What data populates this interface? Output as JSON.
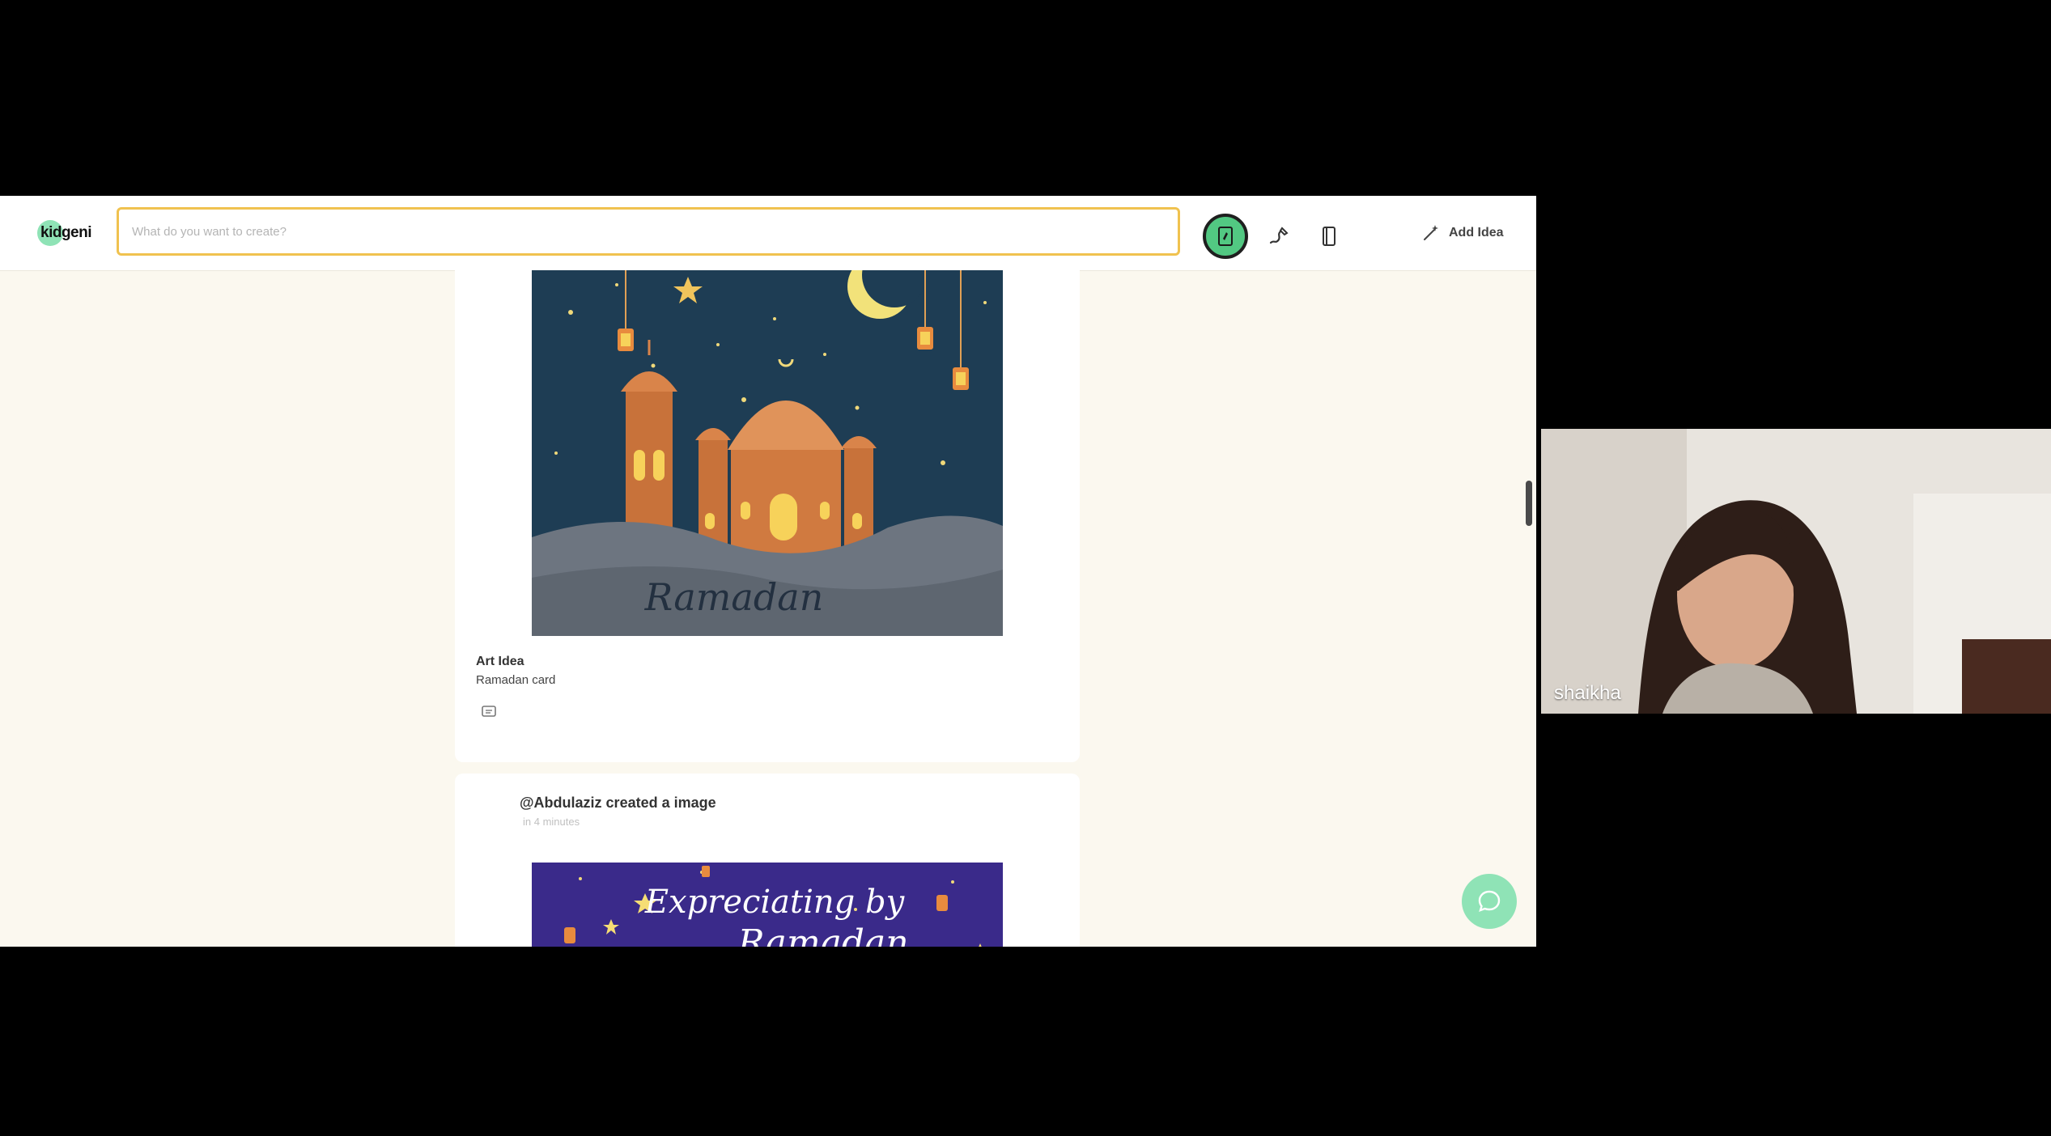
{
  "header": {
    "logo_text": "kidgeni",
    "search_placeholder": "What do you want to create?",
    "tools": [
      "tablet-icon",
      "drawing-icon",
      "book-icon"
    ],
    "add_idea_label": "Add Idea"
  },
  "feed": {
    "card1": {
      "image_caption": "Ramadan",
      "idea_title": "Art Idea",
      "idea_subtitle": "Ramadan card"
    },
    "card2": {
      "creator": "@Abdulaziz created a image",
      "time": "in 4 minutes",
      "image_caption_line1": "Expreciating by",
      "image_caption_line2": "Ramadan"
    }
  },
  "video": {
    "participant_name": "shaikha"
  },
  "colors": {
    "accent_green": "#52c882",
    "search_border": "#f0c24f",
    "page_bg": "#fbf8ef"
  }
}
